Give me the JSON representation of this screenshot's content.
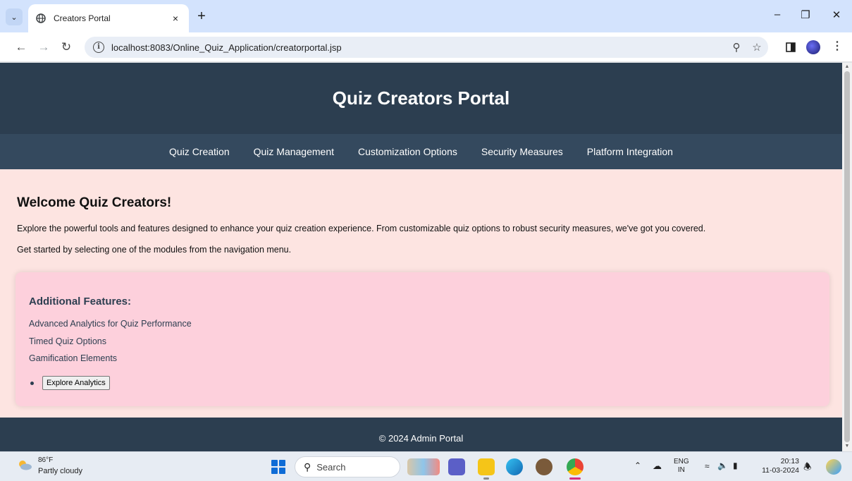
{
  "browser": {
    "tab_title": "Creators Portal",
    "tab_close": "×",
    "new_tab": "+",
    "url": "localhost:8083/Online_Quiz_Application/creatorportal.jsp"
  },
  "page": {
    "header_title": "Quiz Creators Portal",
    "nav_items": [
      "Quiz Creation",
      "Quiz Management",
      "Customization Options",
      "Security Measures",
      "Platform Integration"
    ],
    "welcome_title": "Welcome Quiz Creators!",
    "intro_1": "Explore the powerful tools and features designed to enhance your quiz creation experience. From customizable quiz options to robust security measures, we've got you covered.",
    "intro_2": "Get started by selecting one of the modules from the navigation menu.",
    "features_title": "Additional Features:",
    "features": [
      "Advanced Analytics for Quiz Performance",
      "Timed Quiz Options",
      "Gamification Elements"
    ],
    "explore_button": "Explore Analytics",
    "footer": "© 2024 Admin Portal"
  },
  "taskbar": {
    "temperature": "86°F",
    "weather": "Partly cloudy",
    "search_placeholder": "Search",
    "lang_1": "ENG",
    "lang_2": "IN",
    "time": "20:13",
    "date": "11-03-2024"
  },
  "colors": {
    "header_bg": "#2c3e50",
    "nav_bg": "#34495e",
    "page_bg": "#fde4e1",
    "features_bg": "#fdd0dc"
  }
}
